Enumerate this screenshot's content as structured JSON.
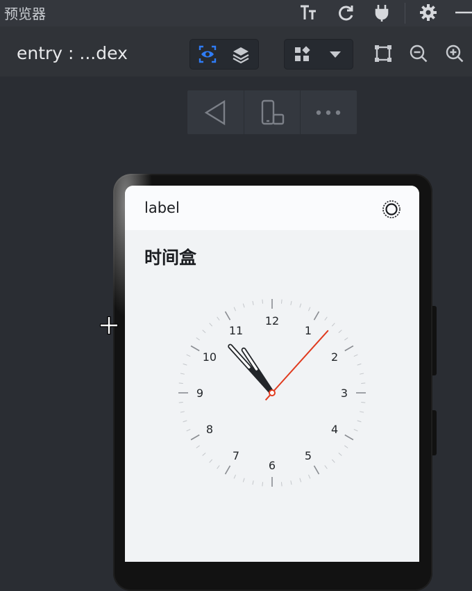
{
  "window": {
    "title": "预览器"
  },
  "toolbar": {
    "entry_label": "entry : ...dex"
  },
  "app": {
    "label": "label",
    "heading": "时间盒",
    "clock": {
      "numbers": [
        "12",
        "1",
        "2",
        "3",
        "4",
        "5",
        "6",
        "7",
        "8",
        "9",
        "10",
        "11"
      ],
      "hour": 10,
      "minute": 53,
      "second": 7,
      "second_hand_color": "#e03a1e",
      "hand_color": "#23262a"
    }
  },
  "colors": {
    "accent": "#2f7cf6"
  }
}
